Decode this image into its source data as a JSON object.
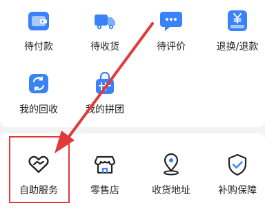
{
  "orders": {
    "pending_payment": {
      "label": "待付款",
      "icon": "wallet-icon"
    },
    "pending_receipt": {
      "label": "待收货",
      "icon": "truck-icon"
    },
    "pending_review": {
      "label": "待评价",
      "icon": "chat-bubble-icon"
    },
    "refund": {
      "label": "退换/退款",
      "icon": "yen-refund-icon"
    }
  },
  "features": {
    "recycle": {
      "label": "我的回收",
      "icon": "recycle-icon"
    },
    "group_buy": {
      "label": "我的拼团",
      "icon": "group-bag-icon"
    }
  },
  "services": {
    "self_service": {
      "label": "自助服务",
      "icon": "handshake-heart-icon"
    },
    "retail_store": {
      "label": "零售店",
      "icon": "store-icon"
    },
    "address": {
      "label": "收货地址",
      "icon": "location-pin-icon"
    },
    "price_protection": {
      "label": "补购保障",
      "icon": "shield-check-icon"
    }
  },
  "colors": {
    "accent_blue": "#3a82f7",
    "light_blue": "#a9c9fb",
    "annotation_red": "#e03a3a",
    "text": "#222222"
  }
}
